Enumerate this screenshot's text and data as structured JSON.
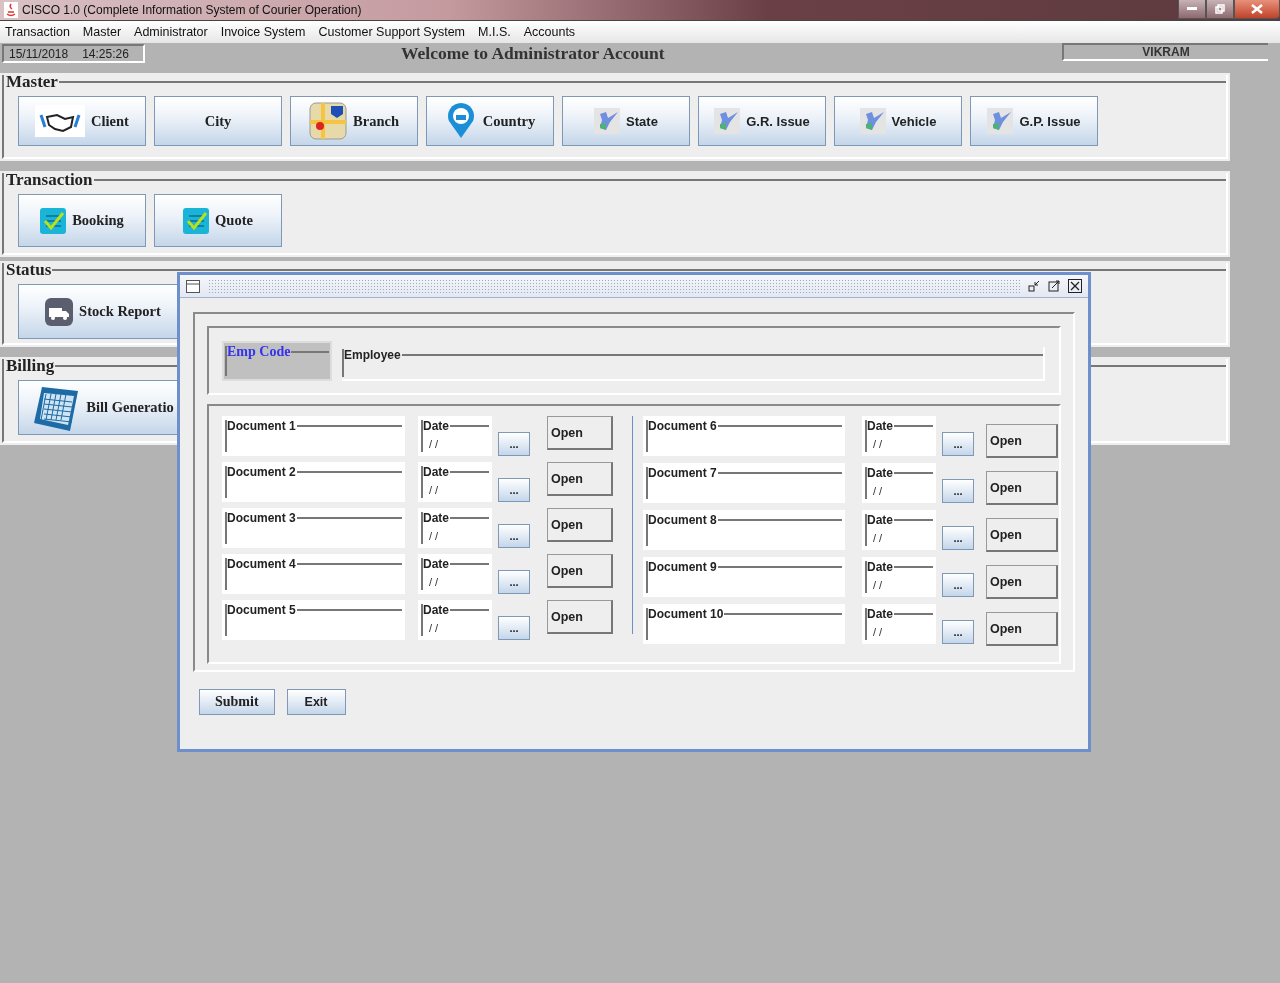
{
  "window": {
    "title": "CISCO 1.0 (Complete Information System of Courier Operation)"
  },
  "menu": [
    {
      "label": "Transaction"
    },
    {
      "label": "Master"
    },
    {
      "label": "Administrator"
    },
    {
      "label": "Invoice System"
    },
    {
      "label": "Customer Support System"
    },
    {
      "label": "M.I.S."
    },
    {
      "label": "Accounts"
    }
  ],
  "status_bar": {
    "date": "15/11/2018",
    "time": "14:25:26",
    "welcome": "Welcome to Administrator Account",
    "user": "VIKRAM"
  },
  "sections": [
    {
      "title": "Master",
      "buttons": [
        {
          "label": "Client",
          "kind": "handshake"
        },
        {
          "label": "City",
          "kind": "plain"
        },
        {
          "label": "Branch",
          "kind": "map"
        },
        {
          "label": "Country",
          "kind": "pin"
        },
        {
          "label": "State",
          "kind": "region"
        },
        {
          "label": "G.R. Issue",
          "kind": "region"
        },
        {
          "label": "Vehicle",
          "kind": "region"
        },
        {
          "label": "G.P. Issue",
          "kind": "region"
        }
      ]
    },
    {
      "title": "Transaction",
      "buttons": [
        {
          "label": "Booking",
          "kind": "checklist"
        },
        {
          "label": "Quote",
          "kind": "checklist"
        }
      ]
    },
    {
      "title": "Status",
      "buttons": [
        {
          "label": "Stock Report",
          "kind": "truck"
        }
      ]
    },
    {
      "title": "Billing",
      "buttons": [
        {
          "label": "Bill Generatio",
          "kind": "calendar"
        }
      ]
    }
  ],
  "dialog": {
    "emp_code_label": "Emp Code",
    "employee_label": "Employee",
    "documents": [
      {
        "label": "Document 1",
        "date_label": "Date",
        "date_value": "/ /",
        "browse": "...",
        "open": "Open"
      },
      {
        "label": "Document 2",
        "date_label": "Date",
        "date_value": "/ /",
        "browse": "...",
        "open": "Open"
      },
      {
        "label": "Document 3",
        "date_label": "Date",
        "date_value": "/ /",
        "browse": "...",
        "open": "Open"
      },
      {
        "label": "Document 4",
        "date_label": "Date",
        "date_value": "/ /",
        "browse": "...",
        "open": "Open"
      },
      {
        "label": "Document 5",
        "date_label": "Date",
        "date_value": "/ /",
        "browse": "...",
        "open": "Open"
      },
      {
        "label": "Document 6",
        "date_label": "Date",
        "date_value": "/ /",
        "browse": "...",
        "open": "Open"
      },
      {
        "label": "Document 7",
        "date_label": "Date",
        "date_value": "/ /",
        "browse": "...",
        "open": "Open"
      },
      {
        "label": "Document 8",
        "date_label": "Date",
        "date_value": "/ /",
        "browse": "...",
        "open": "Open"
      },
      {
        "label": "Document 9",
        "date_label": "Date",
        "date_value": "/ /",
        "browse": "...",
        "open": "Open"
      },
      {
        "label": "Document 10",
        "date_label": "Date",
        "date_value": "/ /",
        "browse": "...",
        "open": "Open"
      }
    ],
    "buttons": [
      {
        "label": "Submit"
      },
      {
        "label": "Exit"
      }
    ]
  }
}
